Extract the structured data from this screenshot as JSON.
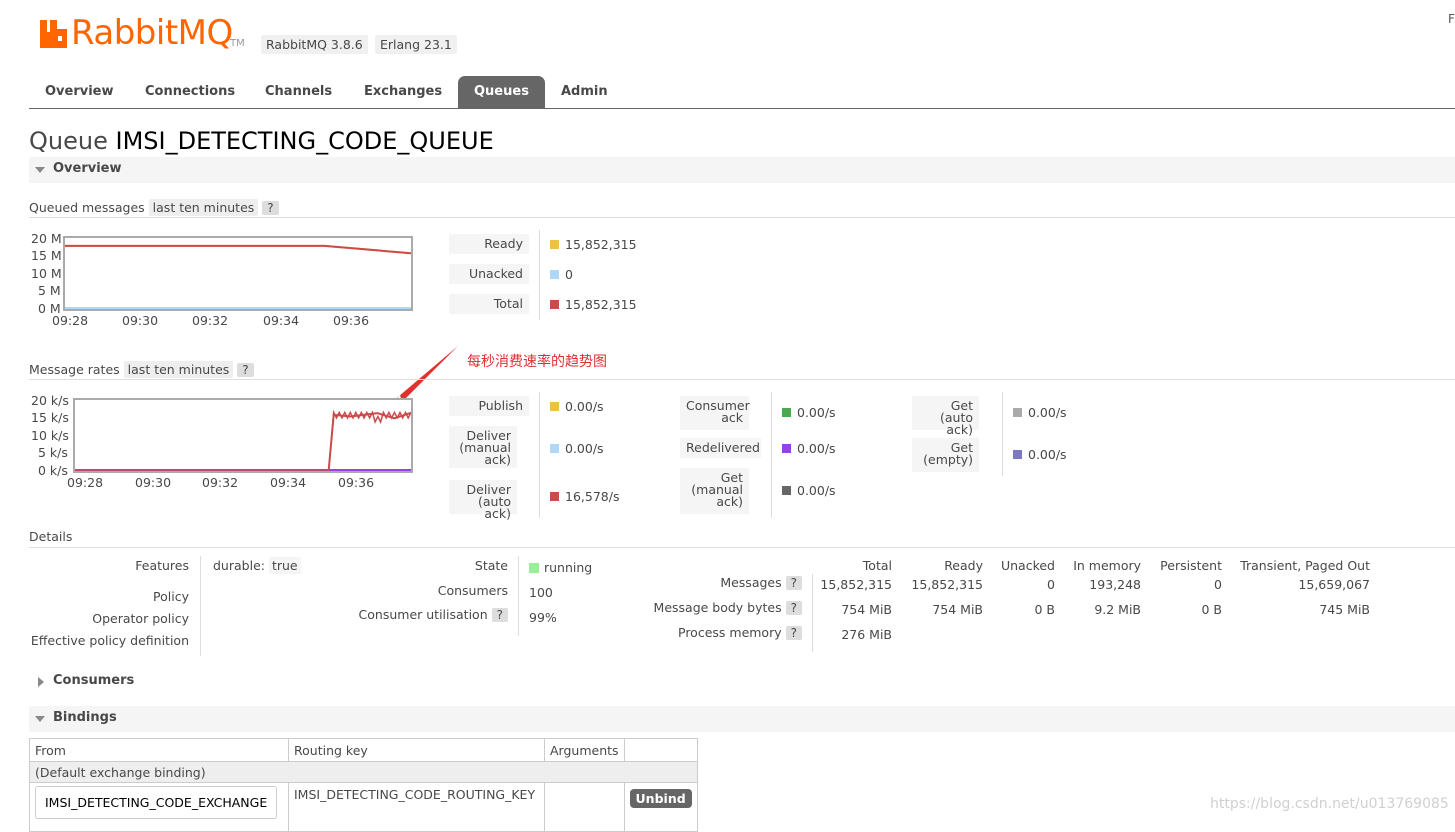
{
  "header": {
    "logo_text": "RabbitMQ",
    "logo_tm": "TM",
    "version_badge": "RabbitMQ 3.8.6",
    "erlang_badge": "Erlang 23.1",
    "corner_char": "F"
  },
  "nav": {
    "tabs": [
      {
        "label": "Overview",
        "active": false
      },
      {
        "label": "Connections",
        "active": false
      },
      {
        "label": "Channels",
        "active": false
      },
      {
        "label": "Exchanges",
        "active": false
      },
      {
        "label": "Queues",
        "active": true
      },
      {
        "label": "Admin",
        "active": false
      }
    ]
  },
  "page": {
    "title_prefix": "Queue",
    "queue_name": "IMSI_DETECTING_CODE_QUEUE"
  },
  "overview_section": {
    "label": "Overview"
  },
  "queued_messages": {
    "label": "Queued messages",
    "range": "last ten minutes",
    "help": "?",
    "y_ticks": [
      "20 M",
      "15 M",
      "10 M",
      "5 M",
      "0 M"
    ],
    "x_ticks": [
      "09:28",
      "09:30",
      "09:32",
      "09:34",
      "09:36"
    ],
    "legend": [
      {
        "label": "Ready",
        "value": "15,852,315",
        "color": "#edc240"
      },
      {
        "label": "Unacked",
        "value": "0",
        "color": "#afd8f8"
      },
      {
        "label": "Total",
        "value": "15,852,315",
        "color": "#cb4b4b"
      }
    ]
  },
  "message_rates": {
    "label": "Message rates",
    "range": "last ten minutes",
    "help": "?",
    "y_ticks": [
      "20 k/s",
      "15 k/s",
      "10 k/s",
      "5 k/s",
      "0 k/s"
    ],
    "x_ticks": [
      "09:28",
      "09:30",
      "09:32",
      "09:34",
      "09:36"
    ],
    "col1": [
      {
        "label": "Publish",
        "value": "0.00/s",
        "color": "#edc240"
      },
      {
        "label": "Deliver (manual ack)",
        "value": "0.00/s",
        "color": "#afd8f8"
      },
      {
        "label": "Deliver (auto ack)",
        "value": "16,578/s",
        "color": "#cb4b4b"
      }
    ],
    "col2": [
      {
        "label": "Consumer ack",
        "value": "0.00/s",
        "color": "#4da74d"
      },
      {
        "label": "Redelivered",
        "value": "0.00/s",
        "color": "#9440ed"
      },
      {
        "label": "Get (manual ack)",
        "value": "0.00/s",
        "color": "#666666"
      }
    ],
    "col3": [
      {
        "label": "Get (auto ack)",
        "value": "0.00/s",
        "color": "#aaaaaa"
      },
      {
        "label": "Get (empty)",
        "value": "0.00/s",
        "color": "#7c79c3"
      }
    ]
  },
  "annotation": {
    "text": "每秒消费速率的趋势图",
    "color": "#e03030"
  },
  "details": {
    "label": "Details",
    "features_label": "Features",
    "features_key": "durable:",
    "features_value": "true",
    "policy_label": "Policy",
    "operator_policy_label": "Operator policy",
    "effective_policy_label": "Effective policy definition",
    "state_label": "State",
    "state_value": "running",
    "state_color": "#99ee99",
    "consumers_label": "Consumers",
    "consumers_value": "100",
    "utilisation_label": "Consumer utilisation",
    "utilisation_help": "?",
    "utilisation_value": "99%",
    "stats": {
      "headers": [
        "Total",
        "Ready",
        "Unacked",
        "In memory",
        "Persistent",
        "Transient, Paged Out"
      ],
      "rows": [
        {
          "label": "Messages",
          "help": "?",
          "values": [
            "15,852,315",
            "15,852,315",
            "0",
            "193,248",
            "0",
            "15,659,067"
          ]
        },
        {
          "label": "Message body bytes",
          "help": "?",
          "values": [
            "754 MiB",
            "754 MiB",
            "0 B",
            "9.2 MiB",
            "0 B",
            "745 MiB"
          ]
        },
        {
          "label": "Process memory",
          "help": "?",
          "values": [
            "276 MiB",
            "",
            "",
            "",
            "",
            ""
          ]
        }
      ]
    }
  },
  "consumers_section": {
    "label": "Consumers"
  },
  "bindings_section": {
    "label": "Bindings",
    "headers": [
      "From",
      "Routing key",
      "Arguments",
      ""
    ],
    "default_binding": "(Default exchange binding)",
    "row": {
      "from": "IMSI_DETECTING_CODE_EXCHANGE",
      "routing_key": "IMSI_DETECTING_CODE_ROUTING_KEY",
      "arguments": "",
      "action": "Unbind"
    }
  },
  "watermark": "https://blog.csdn.net/u013769085",
  "chart_data": [
    {
      "type": "line",
      "title": "Queued messages",
      "x": [
        "09:27",
        "09:28",
        "09:30",
        "09:32",
        "09:34",
        "09:35",
        "09:36",
        "09:37"
      ],
      "ylim": [
        0,
        20000000
      ],
      "yticks": [
        "0 M",
        "5 M",
        "10 M",
        "15 M",
        "20 M"
      ],
      "series": [
        {
          "name": "Ready",
          "color": "#edc240",
          "values": [
            18000000,
            18000000,
            18000000,
            18000000,
            18000000,
            18000000,
            17000000,
            15852315
          ]
        },
        {
          "name": "Unacked",
          "color": "#afd8f8",
          "values": [
            0,
            0,
            0,
            0,
            0,
            0,
            0,
            0
          ]
        },
        {
          "name": "Total",
          "color": "#cb4b4b",
          "values": [
            18000000,
            18000000,
            18000000,
            18000000,
            18000000,
            18000000,
            17000000,
            15852315
          ]
        }
      ]
    },
    {
      "type": "line",
      "title": "Message rates",
      "x": [
        "09:27",
        "09:35",
        "09:35.2",
        "09:35.5",
        "09:36",
        "09:36.5",
        "09:37"
      ],
      "ylim": [
        0,
        20000
      ],
      "yticks": [
        "0 k/s",
        "5 k/s",
        "10 k/s",
        "15 k/s",
        "20 k/s"
      ],
      "series": [
        {
          "name": "Deliver (auto ack)",
          "color": "#cb4b4b",
          "values": [
            0,
            0,
            16000,
            15500,
            16500,
            15000,
            16578
          ]
        },
        {
          "name": "Redelivered",
          "color": "#9440ed",
          "values": [
            0,
            0,
            0,
            0,
            0,
            0,
            0
          ]
        }
      ]
    }
  ]
}
